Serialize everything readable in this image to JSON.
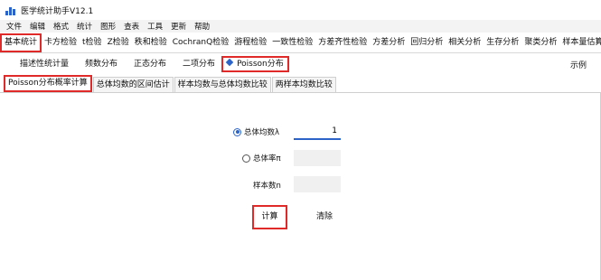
{
  "window": {
    "title": "医学统计助手V12.1",
    "icon": "bar-chart-icon"
  },
  "menu": [
    "文件",
    "编辑",
    "格式",
    "统计",
    "图形",
    "查表",
    "工具",
    "更新",
    "帮助"
  ],
  "main_tabs": [
    "基本统计",
    "卡方检验",
    "t检验",
    "Z检验",
    "秩和检验",
    "CochranQ检验",
    "游程检验",
    "一致性检验",
    "方差齐性检验",
    "方差分析",
    "回归分析",
    "相关分析",
    "生存分析",
    "聚类分析",
    "样本量估算"
  ],
  "sub_tabs": [
    "描述性统计量",
    "频数分布",
    "正态分布",
    "二项分布",
    "Poisson分布"
  ],
  "example_label": "示例",
  "inner_tabs": [
    "Poisson分布概率计算",
    "总体均数的区间估计",
    "样本均数与总体均数比较",
    "两样本均数比较"
  ],
  "form": {
    "mean_label": "总体均数λ",
    "mean_value": "1",
    "rate_label": "总体率π",
    "rate_value": "",
    "n_label": "样本数n",
    "n_value": ""
  },
  "buttons": {
    "calculate": "计算",
    "clear": "清除"
  },
  "colors": {
    "highlight": "#e02a2a",
    "accent": "#2b63c8"
  }
}
